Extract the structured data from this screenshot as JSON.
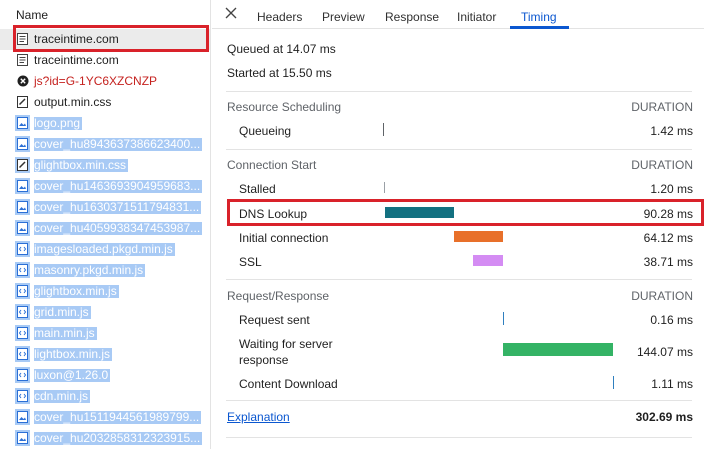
{
  "list": {
    "header": "Name",
    "items": [
      {
        "label": "traceintime.com",
        "icon": "document-icon",
        "state": "selected"
      },
      {
        "label": "traceintime.com",
        "icon": "document-icon",
        "state": "normal"
      },
      {
        "label": "js?id=G-1YC6XZCNZP",
        "icon": "error-icon",
        "state": "error"
      },
      {
        "label": "output.min.css",
        "icon": "stylesheet-icon",
        "state": "normal"
      },
      {
        "label": "logo.png",
        "icon": "image-icon",
        "state": "highlighted"
      },
      {
        "label": "cover_hu8943637386623400...",
        "icon": "image-icon",
        "state": "highlighted"
      },
      {
        "label": "glightbox.min.css",
        "icon": "stylesheet-icon",
        "state": "highlighted"
      },
      {
        "label": "cover_hu1463693904959683...",
        "icon": "image-icon",
        "state": "highlighted"
      },
      {
        "label": "cover_hu1630371511794831...",
        "icon": "image-icon",
        "state": "highlighted"
      },
      {
        "label": "cover_hu4059938347453987...",
        "icon": "image-icon",
        "state": "highlighted"
      },
      {
        "label": "imagesloaded.pkgd.min.js",
        "icon": "script-icon",
        "state": "highlighted"
      },
      {
        "label": "masonry.pkgd.min.js",
        "icon": "script-icon",
        "state": "highlighted"
      },
      {
        "label": "glightbox.min.js",
        "icon": "script-icon",
        "state": "highlighted"
      },
      {
        "label": "grid.min.js",
        "icon": "script-icon",
        "state": "highlighted"
      },
      {
        "label": "main.min.js",
        "icon": "script-icon",
        "state": "highlighted"
      },
      {
        "label": "lightbox.min.js",
        "icon": "script-icon",
        "state": "highlighted"
      },
      {
        "label": "luxon@1.26.0",
        "icon": "script-icon",
        "state": "highlighted"
      },
      {
        "label": "cdn.min.js",
        "icon": "script-icon",
        "state": "highlighted"
      },
      {
        "label": "cover_hu1511944561989799...",
        "icon": "image-icon",
        "state": "highlighted"
      },
      {
        "label": "cover_hu2032858312323915...",
        "icon": "image-icon",
        "state": "highlighted"
      }
    ]
  },
  "tabs": {
    "close_icon": "close-icon",
    "items": [
      "Headers",
      "Preview",
      "Response",
      "Initiator",
      "Timing"
    ],
    "active": "Timing"
  },
  "timing": {
    "queued_at": "Queued at 14.07 ms",
    "started_at": "Started at 15.50 ms",
    "sections": [
      {
        "title": "Resource Scheduling",
        "duration_label": "DURATION",
        "rows": [
          {
            "label": "Queueing",
            "value": "1.42 ms",
            "color": "#5f6368"
          }
        ]
      },
      {
        "title": "Connection Start",
        "duration_label": "DURATION",
        "rows": [
          {
            "label": "Stalled",
            "value": "1.20 ms",
            "color": "#9aa0a6"
          },
          {
            "label": "DNS Lookup",
            "value": "90.28 ms",
            "color": "#137181"
          },
          {
            "label": "Initial connection",
            "value": "64.12 ms",
            "color": "#e8702a"
          },
          {
            "label": "SSL",
            "value": "38.71 ms",
            "color": "#d48cf3"
          }
        ]
      },
      {
        "title": "Request/Response",
        "duration_label": "DURATION",
        "rows": [
          {
            "label": "Request sent",
            "value": "0.16 ms",
            "color": "#2f7fbf"
          },
          {
            "label": "Waiting for server response",
            "label_line1": "Waiting for server",
            "label_line2": "response",
            "value": "144.07 ms",
            "color": "#34b365"
          },
          {
            "label": "Content Download",
            "value": "1.11 ms",
            "color": "#2f7fbf"
          }
        ]
      }
    ],
    "explanation_link": "Explanation",
    "total": "302.69 ms",
    "phases_ms": {
      "queueing": 1.42,
      "stalled": 1.2,
      "dns": 90.28,
      "initial_connection": 64.12,
      "ssl": 38.71,
      "request_sent": 0.16,
      "waiting": 144.07,
      "content_download": 1.11
    }
  },
  "colors": {
    "accent": "#0b57d0",
    "annotation_red": "#d9222a",
    "selection_highlight": "#a8caf5"
  }
}
